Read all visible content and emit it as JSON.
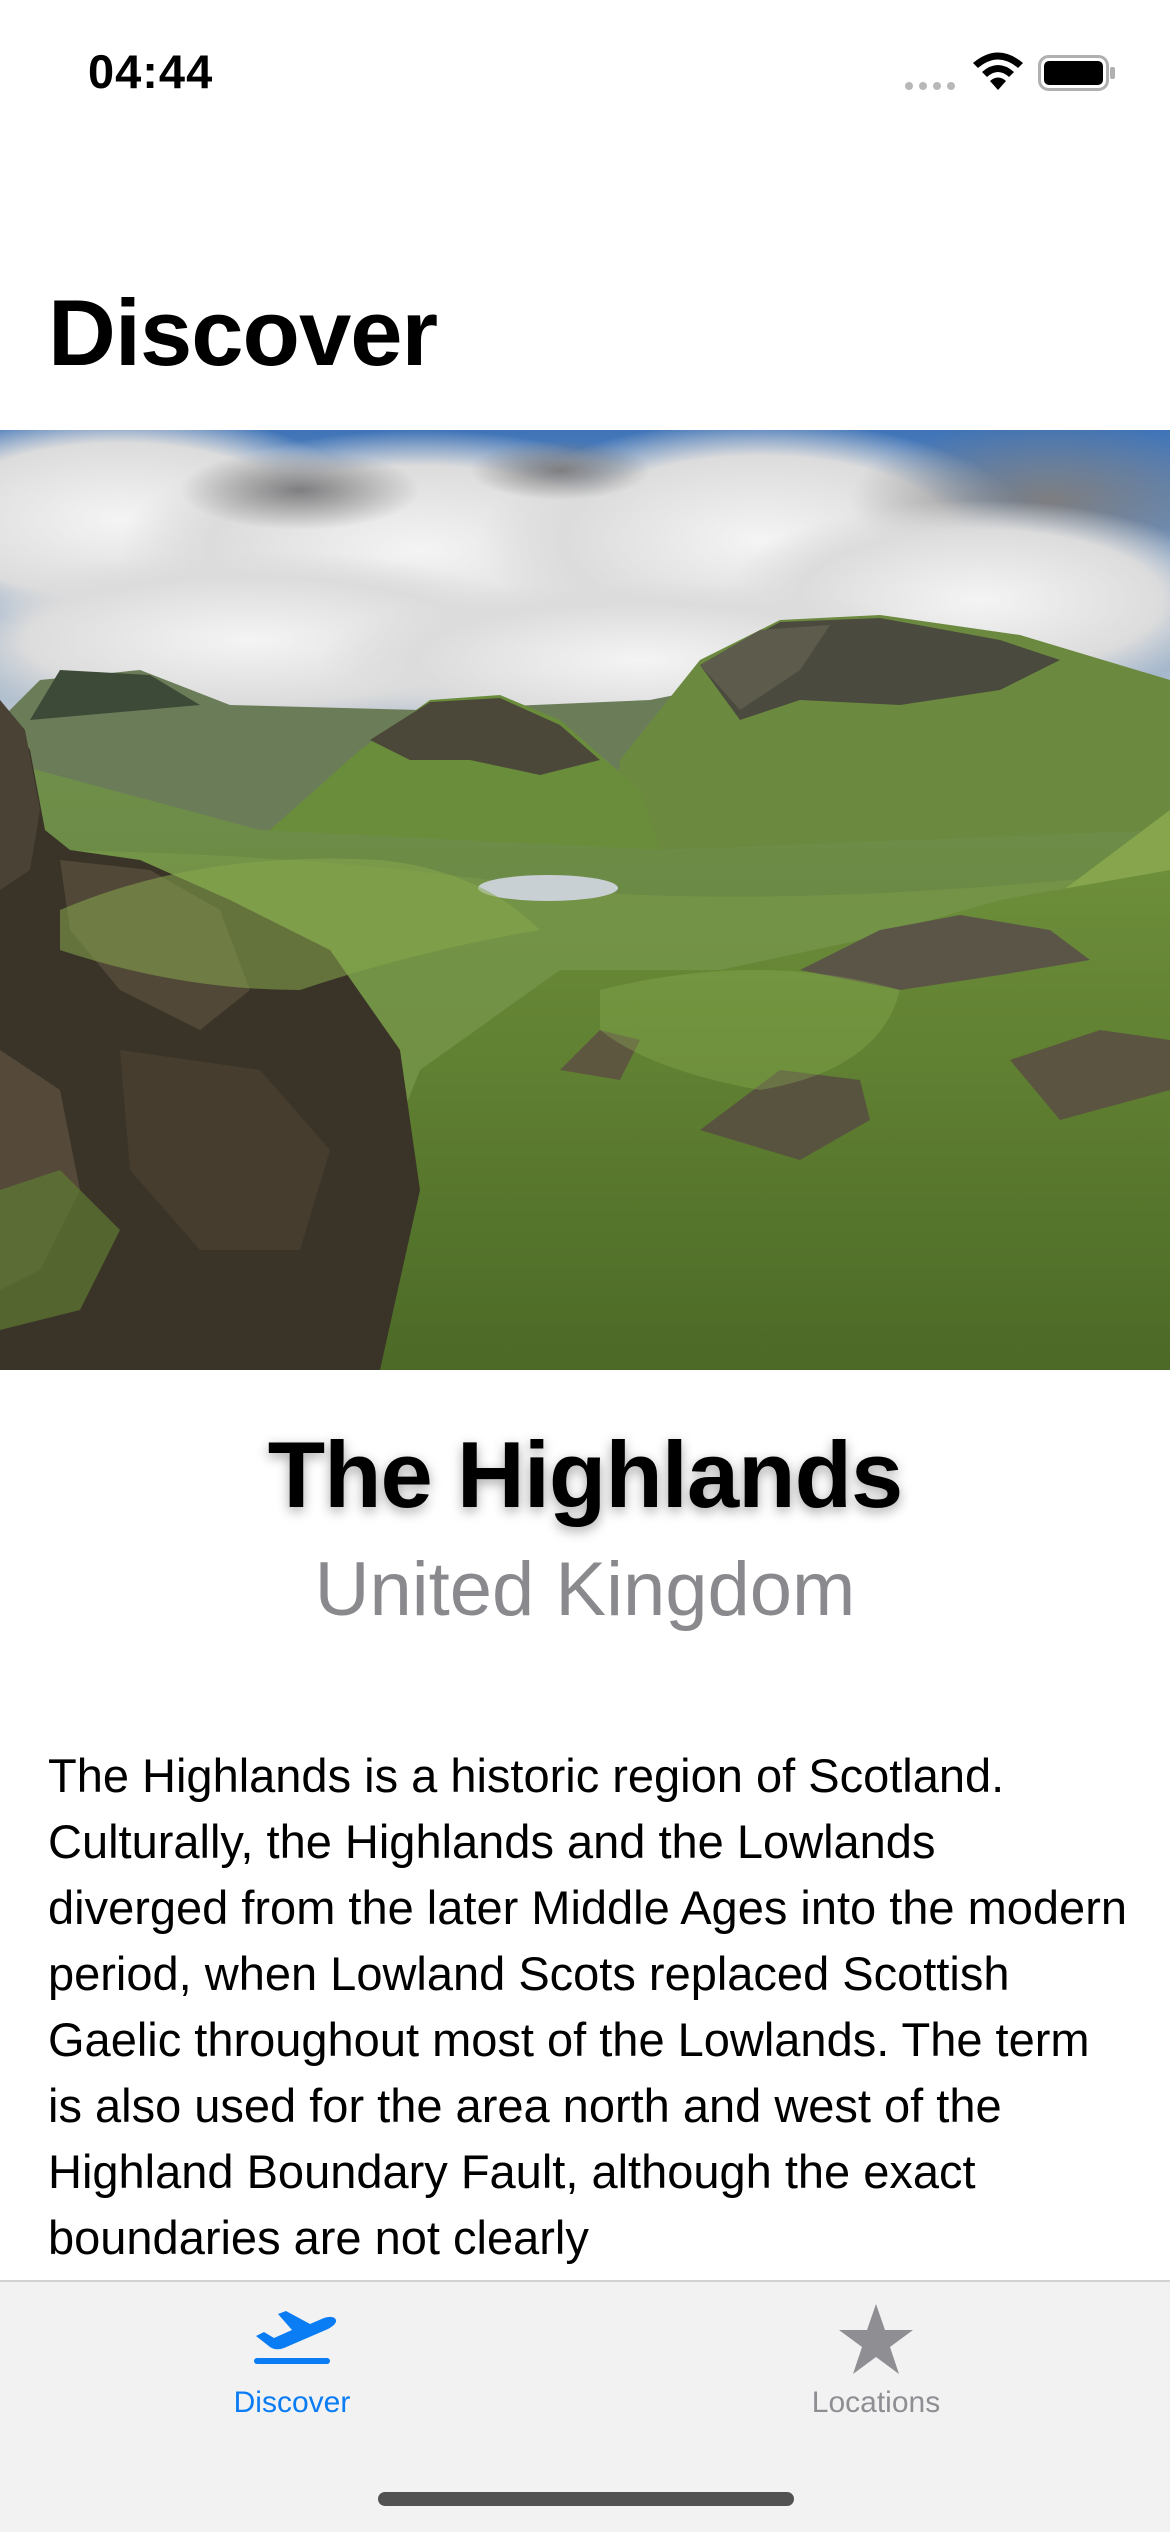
{
  "status_bar": {
    "time": "04:44"
  },
  "header": {
    "title": "Discover"
  },
  "hero": {
    "image_description_icon": "landscape-photo"
  },
  "location": {
    "name": "The Highlands",
    "country": "United Kingdom"
  },
  "description": {
    "text": "The Highlands is a historic region of Scotland. Culturally, the Highlands and the Lowlands diverged from the later Middle Ages into the modern period, when Lowland Scots replaced Scottish Gaelic throughout most of the Lowlands. The term is also used for the area north and west of the Highland Boundary Fault, although the exact boundaries are not clearly"
  },
  "tab_bar": {
    "tabs": [
      {
        "label": "Discover",
        "icon": "airplane-departure-icon",
        "selected": true
      },
      {
        "label": "Locations",
        "icon": "star-icon",
        "selected": false
      }
    ]
  },
  "colors": {
    "accent": "#0a7cf4",
    "inactive": "#8e8e93",
    "secondary_text": "#8a8a8e",
    "tab_bar_bg": "#f2f2f2"
  }
}
